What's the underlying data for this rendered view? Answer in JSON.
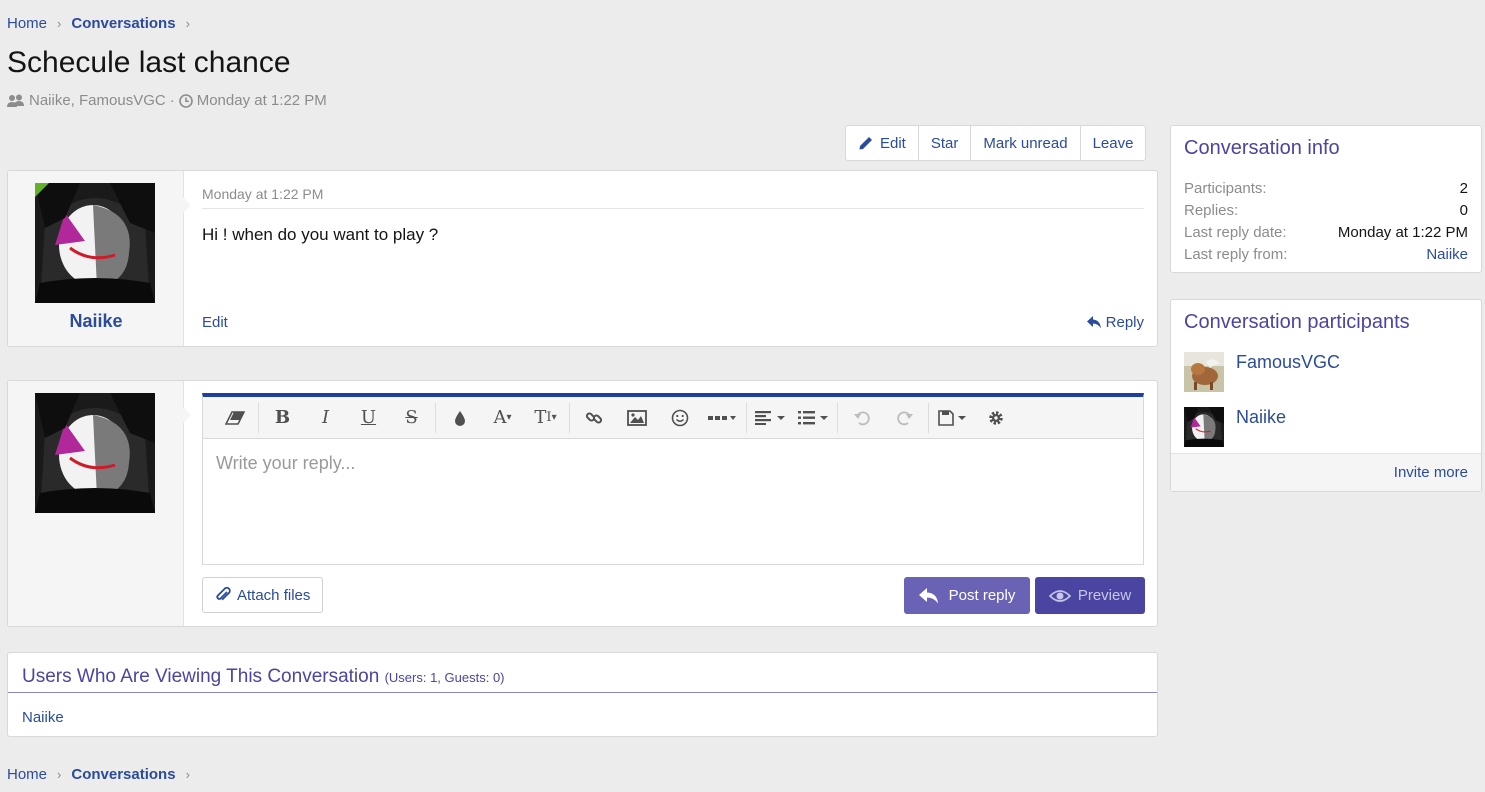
{
  "breadcrumb": {
    "home": "Home",
    "current": "Conversations"
  },
  "title": "Schecule last chance",
  "meta": {
    "participants": "Naiike, FamousVGC",
    "separator": "·",
    "date": "Monday at 1:22 PM"
  },
  "actions": {
    "edit": "Edit",
    "star": "Star",
    "mark_unread": "Mark unread",
    "leave": "Leave"
  },
  "message": {
    "author": "Naiike",
    "date": "Monday at 1:22 PM",
    "text": "Hi ! when do you want to play ?",
    "edit": "Edit",
    "reply": "Reply"
  },
  "editor": {
    "placeholder": "Write your reply...",
    "attach": "Attach files",
    "post": "Post reply",
    "preview": "Preview",
    "toolbar_icons": [
      "eraser-icon",
      "bold-icon",
      "italic-icon",
      "underline-icon",
      "strike-icon",
      "color-icon",
      "font-family-icon",
      "font-size-icon",
      "link-icon",
      "image-icon",
      "smilie-icon",
      "insert-more-icon",
      "align-icon",
      "list-icon",
      "undo-icon",
      "redo-icon",
      "drafts-icon",
      "settings-icon"
    ]
  },
  "viewing": {
    "title": "Users Who Are Viewing This Conversation",
    "counts": "(Users: 1, Guests: 0)",
    "users": "Naiike"
  },
  "info": {
    "title": "Conversation info",
    "rows": [
      {
        "label": "Participants:",
        "value": "2"
      },
      {
        "label": "Replies:",
        "value": "0"
      },
      {
        "label": "Last reply date:",
        "value": "Monday at 1:22 PM"
      },
      {
        "label": "Last reply from:",
        "value": "Naiike"
      }
    ]
  },
  "participants": {
    "title": "Conversation participants",
    "list": [
      {
        "name": "FamousVGC"
      },
      {
        "name": "Naiike"
      }
    ],
    "invite": "Invite more"
  },
  "colors": {
    "link": "#2b4b9b",
    "accent": "#4a45a0",
    "post_button": "#6a63b5",
    "online": "#63b02a",
    "editor_border": "#1d3fa0"
  }
}
